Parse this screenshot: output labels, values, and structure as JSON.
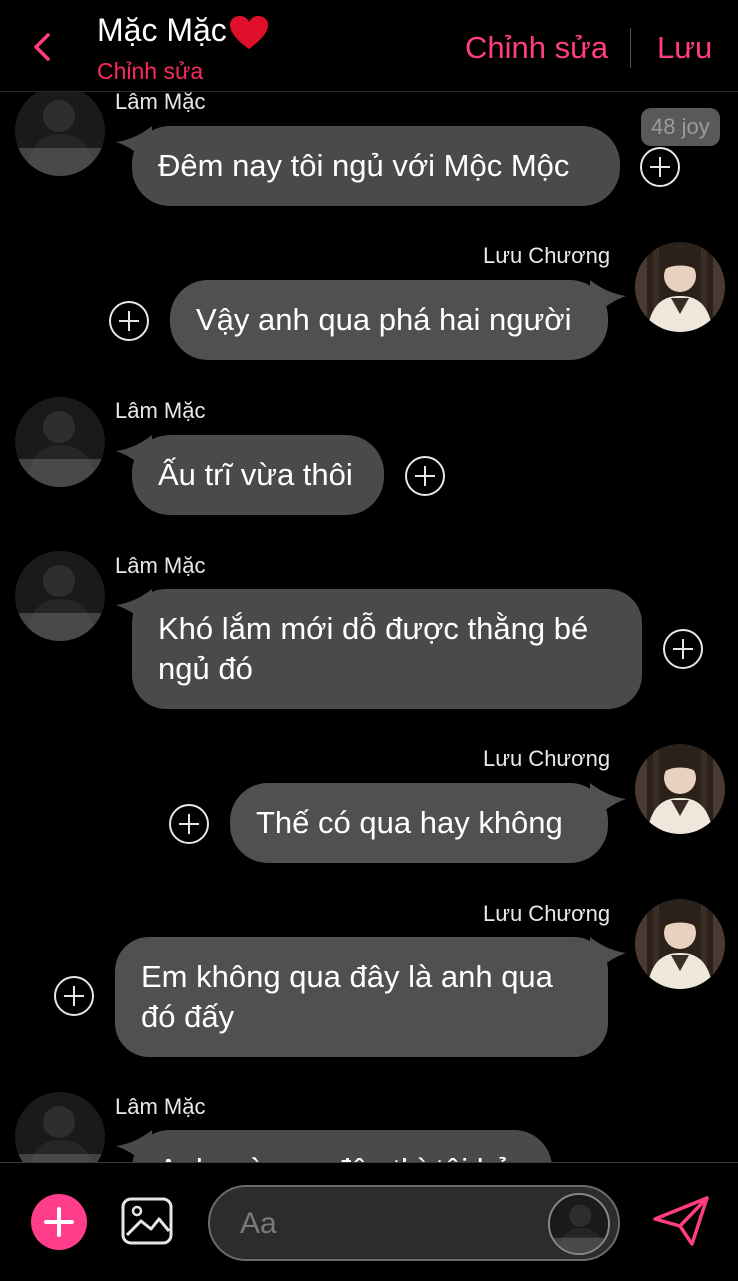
{
  "header": {
    "title": "Mặc Mặc",
    "subtitle": "Chỉnh sửa",
    "edit_label": "Chỉnh sửa",
    "save_label": "Lưu"
  },
  "badge": "48 joy",
  "messages": [
    {
      "sender": "Lâm Mặc",
      "side": "left",
      "text": "Đêm nay tôi ngủ với Mộc Mộc"
    },
    {
      "sender": "Lưu Chương",
      "side": "right",
      "text": "Vậy anh qua phá hai người"
    },
    {
      "sender": "Lâm Mặc",
      "side": "left",
      "text": "Ấu trĩ vừa thôi"
    },
    {
      "sender": "Lâm Mặc",
      "side": "left",
      "text": "Khó lắm mới dỗ được thằng bé\nngủ đó"
    },
    {
      "sender": "Lưu Chương",
      "side": "right",
      "text": "Thế có qua hay không"
    },
    {
      "sender": "Lưu Chương",
      "side": "right",
      "text": "Em không qua đây là anh qua\nđó đấy"
    },
    {
      "sender": "Lâm Mặc",
      "side": "left",
      "text": "Anh mà qua đây thì tôi bỏ"
    }
  ],
  "composer": {
    "placeholder": "Aa"
  },
  "colors": {
    "accent": "#ff3d7f",
    "subtitle": "#ff2a5c",
    "bubble": "#4a4a4a"
  },
  "icons": [
    "back-chevron-icon",
    "heart-icon",
    "add-reaction-icon",
    "plus-icon",
    "image-icon",
    "send-icon"
  ]
}
